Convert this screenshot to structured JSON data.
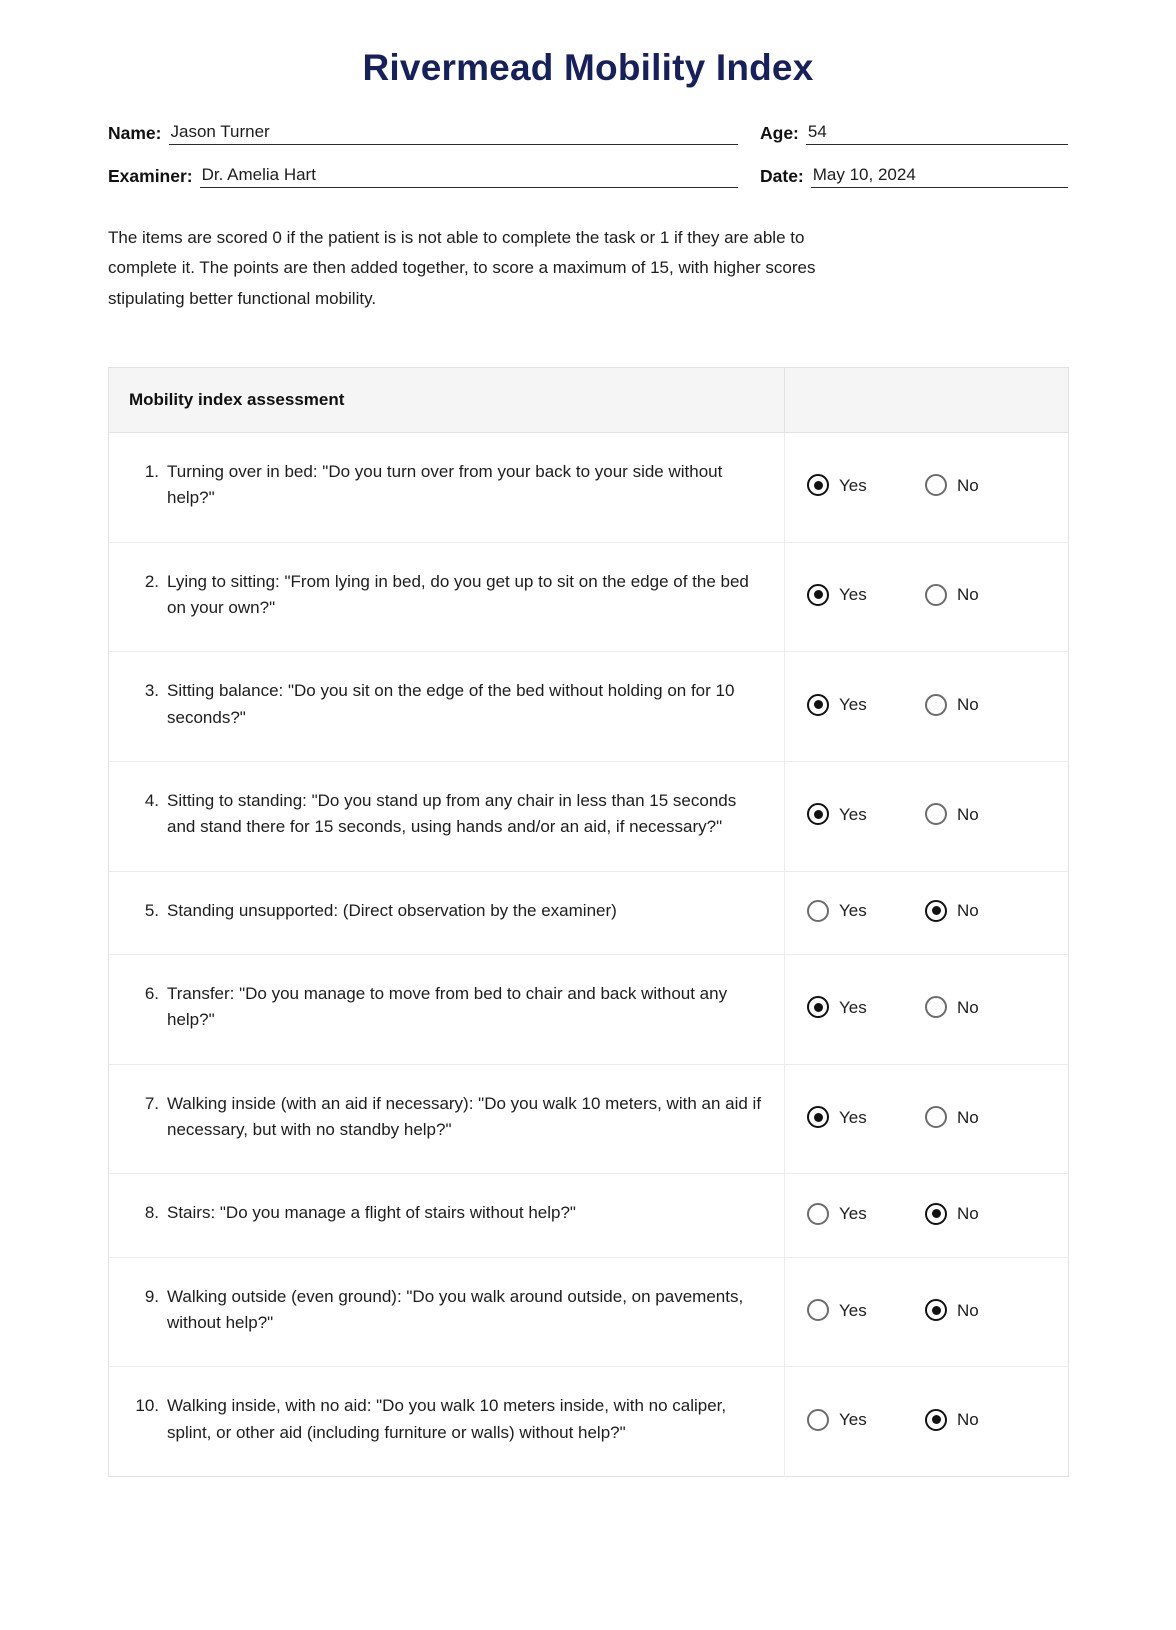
{
  "document": {
    "title": "Rivermead Mobility Index",
    "title_color": "#16205c"
  },
  "identity": {
    "name_label": "Name:",
    "name_value": "Jason Turner",
    "age_label": "Age:",
    "age_value": "54",
    "examiner_label": "Examiner:",
    "examiner_value": "Dr. Amelia Hart",
    "date_label": "Date:",
    "date_value": "May 10, 2024"
  },
  "intro": {
    "text": "The items are scored 0 if the patient is is not able to complete the task or 1 if they are able to complete it. The points are then added together, to score a maximum of 15, with higher scores stipulating better functional mobility."
  },
  "table": {
    "header_item": "Mobility index assessment",
    "header_answer": "",
    "yes_label": "Yes",
    "no_label": "No",
    "rows": [
      {
        "number": "1.",
        "text": "Turning over in bed: \"Do you turn over from your back to your side without help?\"",
        "answer": "Yes"
      },
      {
        "number": "2.",
        "text": "Lying to sitting: \"From lying in bed, do you get up to sit on the edge of the bed on your own?\"",
        "answer": "Yes"
      },
      {
        "number": "3.",
        "text": "Sitting balance: \"Do you sit on the edge of the bed without holding on for 10 seconds?\"",
        "answer": "Yes"
      },
      {
        "number": "4.",
        "text": "Sitting to standing: \"Do you stand up from any chair in less than 15 seconds and stand there for 15 seconds, using hands and/or an aid, if necessary?\"",
        "answer": "Yes"
      },
      {
        "number": "5.",
        "text": "Standing unsupported: (Direct observation by the examiner)",
        "answer": "No"
      },
      {
        "number": "6.",
        "text": "Transfer: \"Do you manage to move from bed to chair and back without any help?\"",
        "answer": "Yes"
      },
      {
        "number": "7.",
        "text": "Walking inside (with an aid if necessary): \"Do you walk 10 meters, with an aid if necessary, but with no standby help?\"",
        "answer": "Yes"
      },
      {
        "number": "8.",
        "text": "Stairs: \"Do you manage a flight of stairs without help?\"",
        "answer": "No"
      },
      {
        "number": "9.",
        "text": "Walking outside (even ground): \"Do you walk around outside, on pavements, without help?\"",
        "answer": "No"
      },
      {
        "number": "10.",
        "text": "Walking inside, with no aid: \"Do you walk 10 meters inside, with no caliper, splint, or other aid (including furniture or walls) without help?\"",
        "answer": "No"
      }
    ]
  }
}
